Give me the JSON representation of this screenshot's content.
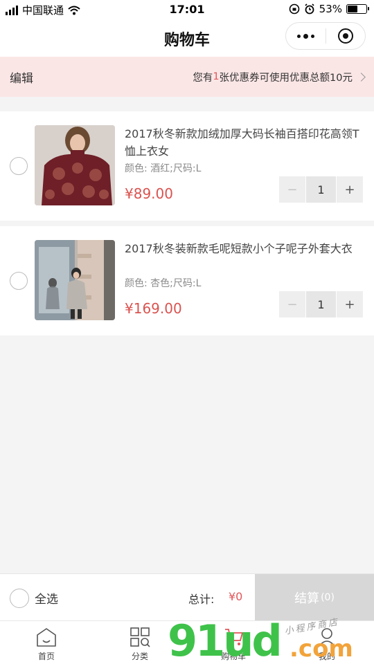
{
  "status_bar": {
    "carrier": "中国联通",
    "time": "17:01",
    "battery": "53%"
  },
  "nav": {
    "title": "购物车"
  },
  "coupon_bar": {
    "edit_label": "编辑",
    "text_prefix": "您有",
    "count": "1",
    "text_suffix": "张优惠券可使用优惠总额10元"
  },
  "items": [
    {
      "title": "2017秋冬新款加绒加厚大码长袖百搭印花高领T恤上衣女",
      "spec": "颜色: 酒红;尺码:L",
      "price": "¥89.00",
      "qty": "1",
      "minus": "−",
      "plus": "+"
    },
    {
      "title": "2017秋冬装新款毛呢短款小个子呢子外套大衣",
      "spec": "颜色: 杏色;尺码:L",
      "price": "¥169.00",
      "qty": "1",
      "minus": "−",
      "plus": "+"
    }
  ],
  "checkout": {
    "select_all": "全选",
    "total_label": "总计:",
    "total_value": "¥0",
    "button_label": "结算",
    "button_count": "(0)"
  },
  "tabs": [
    {
      "label": "首页",
      "icon": "home-icon"
    },
    {
      "label": "分类",
      "icon": "category-icon"
    },
    {
      "label": "购物车",
      "icon": "cart-icon"
    },
    {
      "label": "我的",
      "icon": "user-icon"
    }
  ],
  "watermark": {
    "number": "91ud",
    "domain": ".com",
    "handwriting": "小程序商店"
  },
  "colors": {
    "accent": "#e0565a",
    "coupon_bg": "#fbe6e6",
    "checkout_disabled": "#d7d7d7"
  }
}
